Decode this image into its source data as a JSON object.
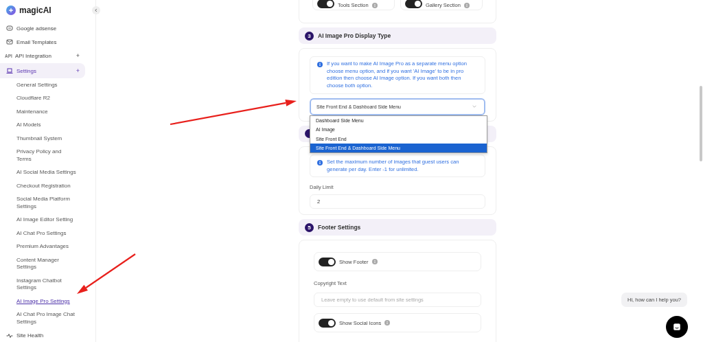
{
  "sidebar": {
    "logo": "magicAI",
    "items": [
      {
        "label": "Google adsense",
        "selected": false
      },
      {
        "label": "Email Templates",
        "selected": false
      },
      {
        "label": "API Integration",
        "icon_text": "API",
        "toggle": "+",
        "selected": false
      },
      {
        "label": "Settings",
        "toggle": "+",
        "selected": true,
        "children": [
          {
            "label": "General Settings",
            "selected": false
          },
          {
            "label": "Cloudflare R2",
            "selected": false
          },
          {
            "label": "Maintenance",
            "selected": false
          },
          {
            "label": "AI Models",
            "selected": false
          },
          {
            "label": "Thumbnail System",
            "selected": false
          },
          {
            "label": "Privacy Policy and Terms",
            "selected": false
          },
          {
            "label": "AI Social Media Settings",
            "selected": false
          },
          {
            "label": "Checkout Registration",
            "selected": false
          },
          {
            "label": "Social Media Platform Settings",
            "selected": false
          },
          {
            "label": "AI Image Editor Setting",
            "selected": false
          },
          {
            "label": "AI Chat Pro Settings",
            "selected": false
          },
          {
            "label": "Premium Advantages",
            "selected": false
          },
          {
            "label": "Content Manager Settings",
            "selected": false
          },
          {
            "label": "Instagram Chatbot Settings",
            "selected": false
          },
          {
            "label": "AI Image Pro Settings",
            "selected": true
          },
          {
            "label": "AI Chat Pro Image Chat Settings",
            "selected": false
          }
        ]
      },
      {
        "label": "Site Health",
        "selected": false
      }
    ]
  },
  "top_card": {
    "toggles": [
      {
        "label": "Tools Section",
        "on": true
      },
      {
        "label": "Gallery Section",
        "on": true
      }
    ]
  },
  "sections": [
    {
      "number": "3",
      "title": "AI Image Pro Display Type",
      "fields": [
        {
          "kind": "info",
          "text": "If you want to make AI Image Pro as a separate menu option choose menu option, and if you want 'AI Image' to be in pro edition then choose AI Image option. If you want both then choose both option."
        },
        {
          "kind": "select",
          "value": "Site Front End & Dashboard Side Menu",
          "expanded": true,
          "options": [
            {
              "label": "Dashboard Side Menu",
              "selected": false
            },
            {
              "label": "AI Image",
              "selected": false
            },
            {
              "label": "Site Front End",
              "selected": false
            },
            {
              "label": "Site Front End & Dashboard Side Menu",
              "selected": true
            }
          ]
        }
      ]
    },
    {
      "fields": [
        {
          "kind": "info",
          "text": "Set the maximum number of images that guest users can generate per day. Enter -1 for unlimited."
        },
        {
          "kind": "input",
          "label": "Daily Limit",
          "value": "2"
        }
      ]
    },
    {
      "number": "5",
      "title": "Footer Settings",
      "fields": [
        {
          "kind": "toggle",
          "label": "Show Footer",
          "on": true
        },
        {
          "kind": "input",
          "label": "Copyright Text",
          "placeholder": "Leave empty to use default from site settings"
        },
        {
          "kind": "toggle",
          "label": "Show Social Icons",
          "on": true
        }
      ]
    }
  ],
  "chat": {
    "greeting": "Hi, how can I help you?"
  },
  "annotations": [
    {
      "kind": "arrow"
    },
    {
      "kind": "arrow"
    }
  ]
}
